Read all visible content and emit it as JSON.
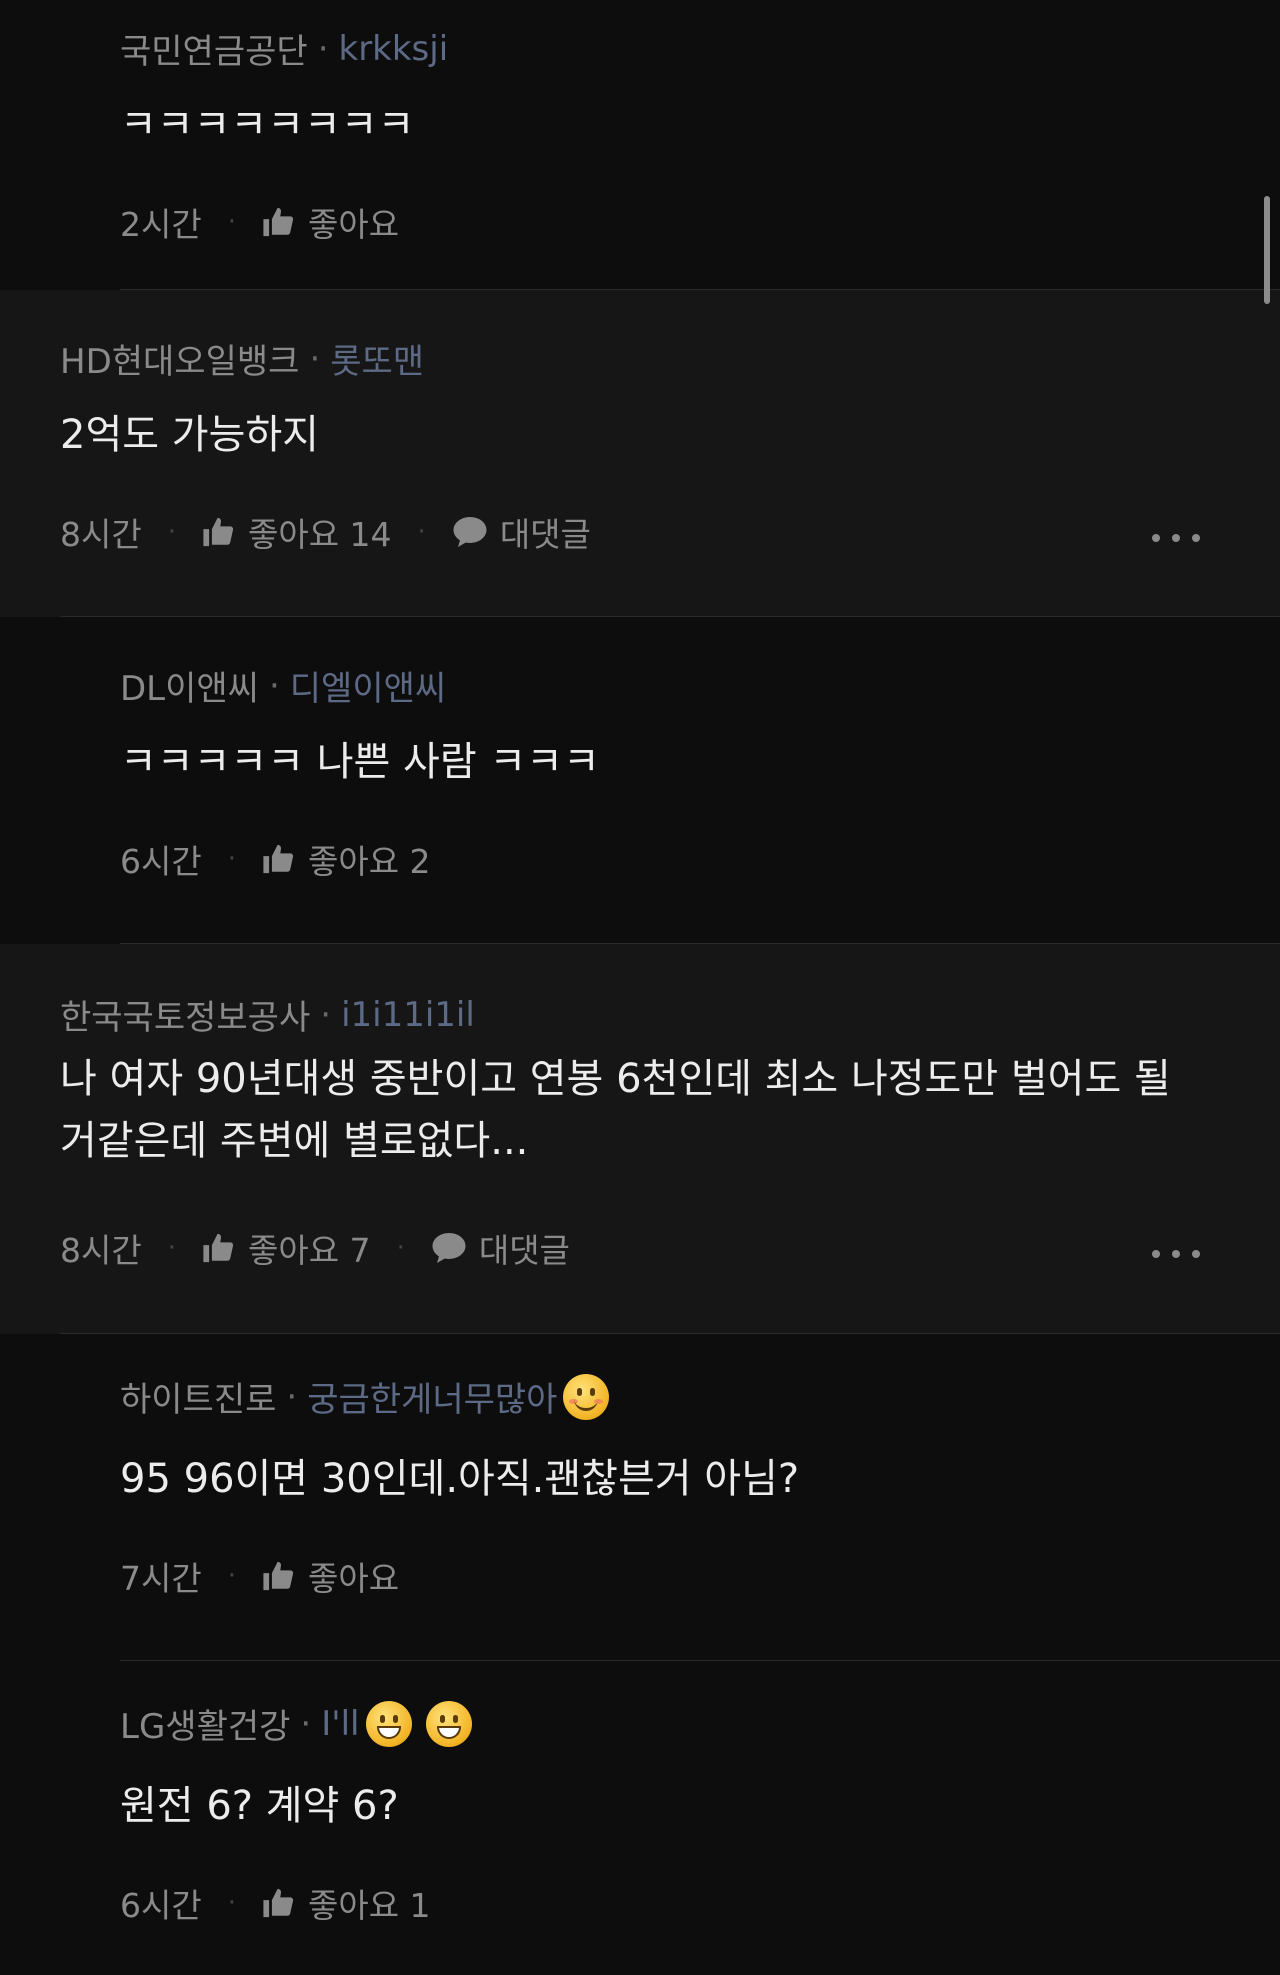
{
  "comments": [
    {
      "company": "국민연금공단",
      "nickname": "krkksji",
      "text": "ㅋㅋㅋㅋㅋㅋㅋㅋ",
      "time": "2시간",
      "like_label": "좋아요"
    },
    {
      "company": "HD현대오일뱅크",
      "nickname": "롯또맨",
      "text": "2억도 가능하지",
      "time": "8시간",
      "like_label": "좋아요 14",
      "reply_label": "대댓글"
    },
    {
      "company": "DL이앤씨",
      "nickname": "디엘이앤씨",
      "text": "ㅋㅋㅋㅋㅋ 나쁜 사람 ㅋㅋㅋ",
      "time": "6시간",
      "like_label": "좋아요 2"
    },
    {
      "company": "한국국토정보공사",
      "nickname": "i1i11i1il",
      "text": "나 여자 90년대생 중반이고 연봉 6천인데 최소 나정도만 벌어도 될 거같은데 주변에 별로없다...",
      "time": "8시간",
      "like_label": "좋아요 7",
      "reply_label": "대댓글"
    },
    {
      "company": "하이트진로",
      "nickname": "궁금한게너무많아",
      "emoji": "blush-smile-emoji",
      "text": "95 96이면 30인데.아직.괜찮븐거 아님?",
      "time": "7시간",
      "like_label": "좋아요"
    },
    {
      "company": "LG생활건강",
      "nickname": "I'll",
      "emoji": "grin-emoji",
      "text": "원전 6? 계약 6?",
      "time": "6시간",
      "like_label": "좋아요 1"
    }
  ],
  "icons": {
    "like": "thumbs-up-icon",
    "reply": "speech-bubble-icon",
    "more": "more-dots-icon"
  },
  "colors": {
    "background": "#0d0d0d",
    "top_level_background": "#161616",
    "nickname": "#5d6a86",
    "meta": "#8a8a8a"
  }
}
